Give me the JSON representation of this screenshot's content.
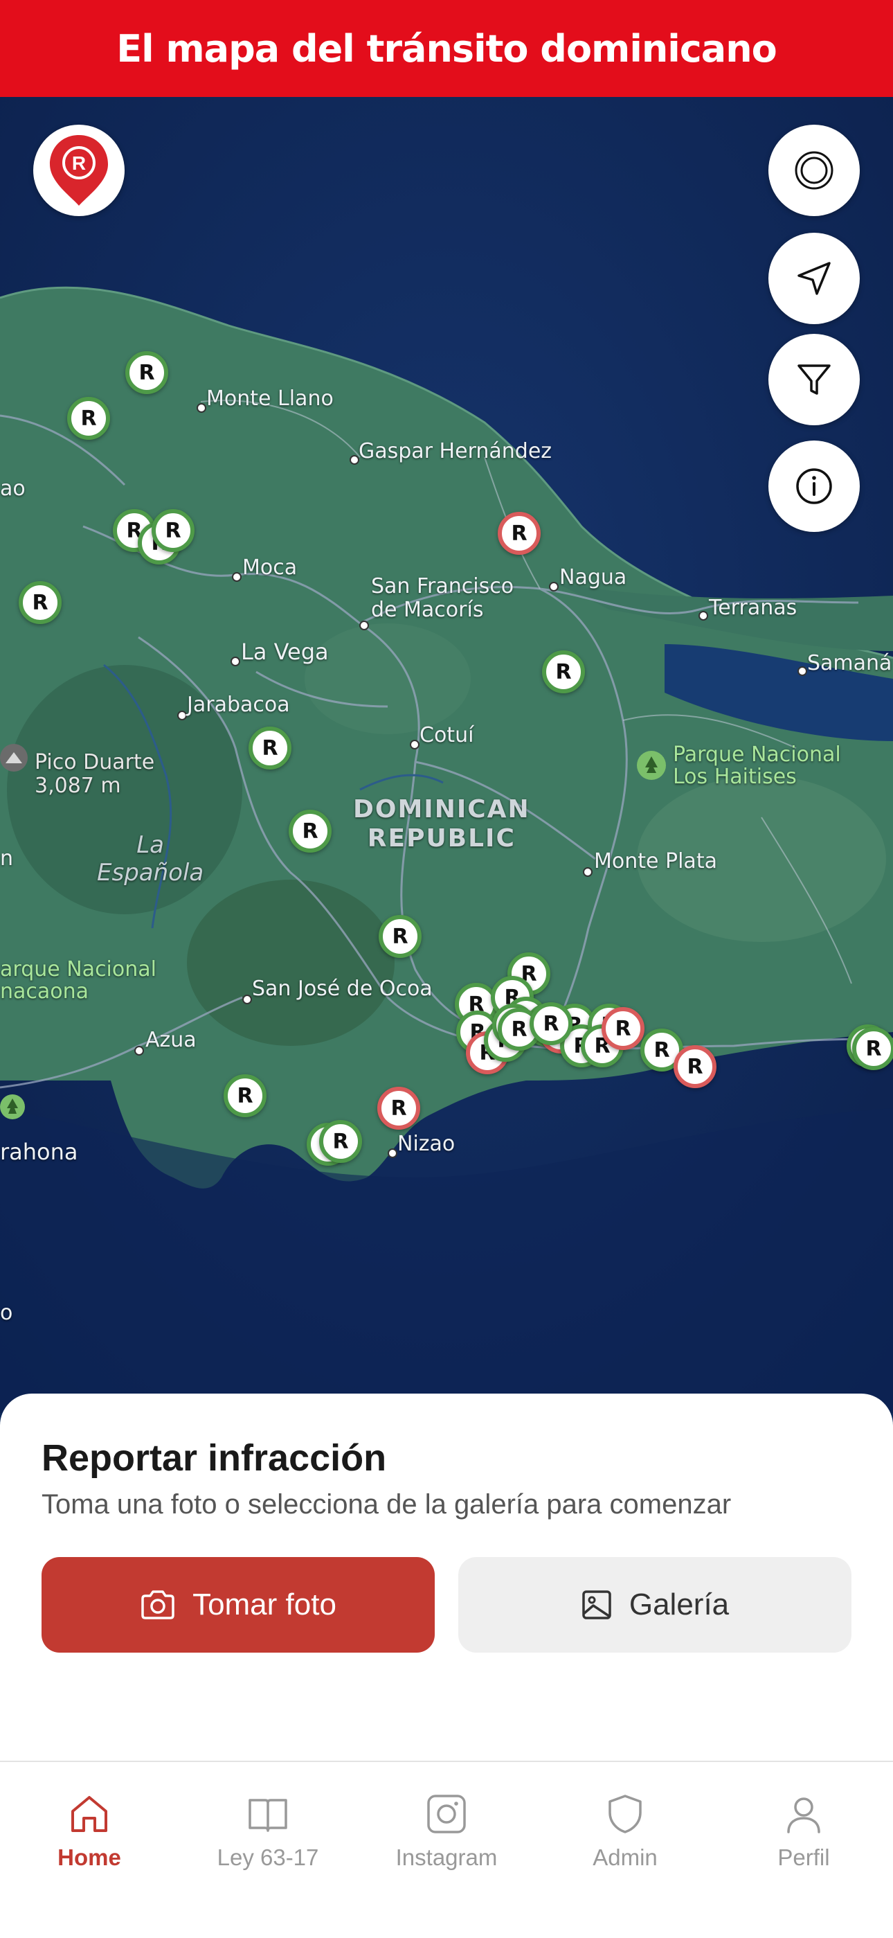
{
  "header": {
    "title": "El mapa del tránsito dominicano"
  },
  "map": {
    "logo_icon": "app-logo-pin-icon",
    "controls": [
      {
        "name": "layers-button",
        "icon": "layers-circle-icon"
      },
      {
        "name": "locate-button",
        "icon": "navigation-arrow-icon"
      },
      {
        "name": "filter-button",
        "icon": "funnel-filter-icon"
      },
      {
        "name": "info-button",
        "icon": "info-circle-icon"
      }
    ],
    "places": {
      "monte_llano": "Monte Llano",
      "gaspar": "Gaspar Hernández",
      "ao": "ao",
      "moca": "Moca",
      "san_francisco": "San Francisco\nde Macorís",
      "nagua": "Nagua",
      "terranas": "Terranas",
      "samana": "Samaná",
      "la_vega": "La Vega",
      "jarabacoa": "Jarabacoa",
      "cotui": "Cotuí",
      "pico_duarte": "Pico Duarte\n3,087 m",
      "los_haitises": "Parque Nacional\nLos Haitises",
      "dominican_republic": "DOMINICAN\nREPUBLIC",
      "la_espanola": "La\nEspañola",
      "n": "n",
      "monte_plata": "Monte Plata",
      "parque_nacional_2": "arque Nacional\nnacaona",
      "san_jose": "San José de Ocoa",
      "azua": "Azua",
      "barahona": "rahona",
      "nizao": "Nizao",
      "o": "o"
    },
    "marker_label": "R",
    "colors": {
      "green": "#4e9a48",
      "red": "#d95b5b"
    }
  },
  "sheet": {
    "title": "Reportar infracción",
    "subtitle": "Toma una foto o selecciona de la galería para comenzar",
    "take_photo": "Tomar foto",
    "gallery": "Galería"
  },
  "tabs": [
    {
      "label": "Home",
      "icon": "home-icon",
      "active": true
    },
    {
      "label": "Ley 63-17",
      "icon": "book-icon",
      "active": false
    },
    {
      "label": "Instagram",
      "icon": "instagram-icon",
      "active": false
    },
    {
      "label": "Admin",
      "icon": "shield-icon",
      "active": false
    },
    {
      "label": "Perfil",
      "icon": "user-icon",
      "active": false
    }
  ],
  "colors": {
    "accent": "#e30d1b",
    "primary_button": "#c23a31"
  }
}
